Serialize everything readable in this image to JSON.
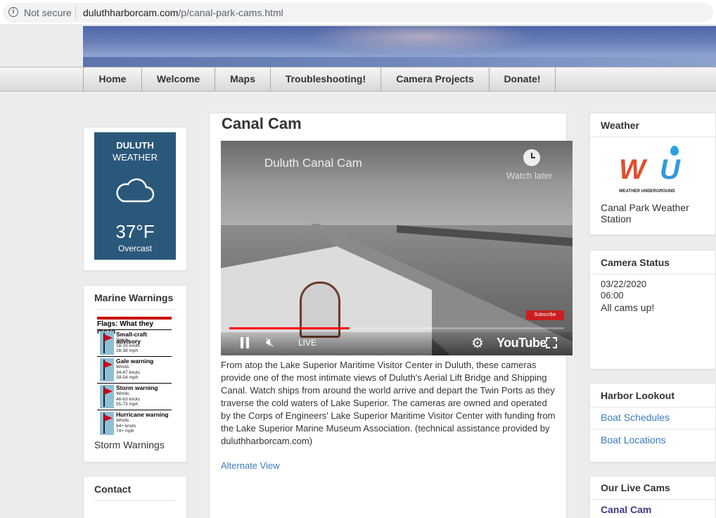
{
  "browser": {
    "security": "Not secure",
    "url_domain": "duluthharborcam.com",
    "url_path": "/p/canal-park-cams.html"
  },
  "nav": {
    "tabs": [
      "Home",
      "Welcome",
      "Maps",
      "Troubleshooting!",
      "Camera Projects",
      "Donate!"
    ]
  },
  "weather_widget": {
    "city": "DULUTH",
    "label": "WEATHER",
    "temperature": "37°F",
    "condition": "Overcast"
  },
  "marine": {
    "title": "Marine Warnings",
    "flags_title": "Flags: What they mean",
    "flags": [
      {
        "name": "Small-craft advisory",
        "details": "Winds:\n18-33 knots\n28-38 mph"
      },
      {
        "name": "Gale warning",
        "details": "Winds:\n34-47 knots\n39-54 mph"
      },
      {
        "name": "Storm warning",
        "details": "Winds:\n48-63 knots\n55-73 mph"
      },
      {
        "name": "Hurricane warning",
        "details": "Winds:\n64+ knots\n74+ mph"
      }
    ],
    "caption": "Storm Warnings"
  },
  "contact": {
    "title": "Contact"
  },
  "main": {
    "title": "Canal Cam",
    "video": {
      "title": "Duluth Canal Cam",
      "watch_later": "Watch later",
      "subscribe": "Subscribe",
      "live": "LIVE",
      "brand": "YouTube",
      "progress": 0.36
    },
    "description": "From atop the Lake Superior Maritime Visitor Center in Duluth, these cameras provide one of the most intimate views of Duluth's Aerial Lift Bridge and Shipping Canal. Watch ships from around the world arrive and depart the Twin Ports as they traverse the cold waters of Lake Superior. The cameras are owned and operated by the Corps of Engineers' Lake Superior Maritime Visitor Center with funding from the Lake Superior Marine Museum Association. (technical assistance provided by duluthharborcam.com)",
    "alt_view": "Alternate View"
  },
  "weather_panel": {
    "title": "Weather",
    "logo_text": "WEATHER UNDERGROUND",
    "link": "Canal Park Weather Station"
  },
  "camera_status": {
    "title": "Camera Status",
    "date": "03/22/2020",
    "time": "06:00",
    "message": "All cams up!"
  },
  "harbor": {
    "title": "Harbor Lookout",
    "links": [
      "Boat Schedules",
      "Boat Locations"
    ]
  },
  "live_cams": {
    "title": "Our Live Cams",
    "first": "Canal Cam"
  },
  "colors": {
    "link": "#3a7bc0",
    "weather_box": "#2a587a",
    "progress": "#ff0000"
  }
}
